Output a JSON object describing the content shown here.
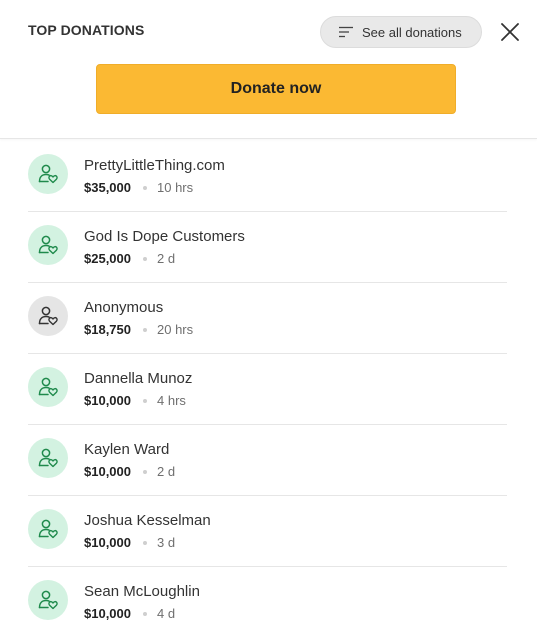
{
  "header": {
    "title": "TOP DONATIONS",
    "see_all_label": "See all donations",
    "donate_label": "Donate now"
  },
  "colors": {
    "donate_button": "#fbb933",
    "avatar_green": "#d3f2e1",
    "avatar_gray": "#e5e5e5",
    "icon_green": "#1f8a4c"
  },
  "donations": [
    {
      "name": "PrettyLittleThing.com",
      "amount": "$35,000",
      "time": "10 hrs",
      "avatar": "green"
    },
    {
      "name": "God Is Dope Customers",
      "amount": "$25,000",
      "time": "2 d",
      "avatar": "green"
    },
    {
      "name": "Anonymous",
      "amount": "$18,750",
      "time": "20 hrs",
      "avatar": "gray"
    },
    {
      "name": "Dannella Munoz",
      "amount": "$10,000",
      "time": "4 hrs",
      "avatar": "green"
    },
    {
      "name": "Kaylen Ward",
      "amount": "$10,000",
      "time": "2 d",
      "avatar": "green"
    },
    {
      "name": "Joshua Kesselman",
      "amount": "$10,000",
      "time": "3 d",
      "avatar": "green"
    },
    {
      "name": "Sean McLoughlin",
      "amount": "$10,000",
      "time": "4 d",
      "avatar": "green"
    }
  ]
}
